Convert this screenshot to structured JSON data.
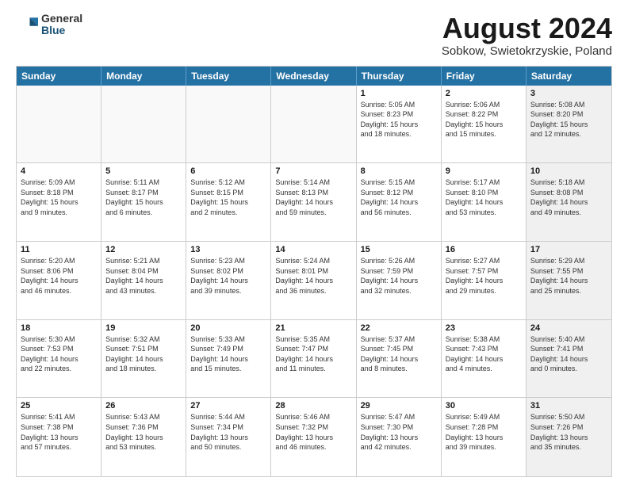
{
  "logo": {
    "general": "General",
    "blue": "Blue"
  },
  "title": "August 2024",
  "location": "Sobkow, Swietokrzyskie, Poland",
  "dayHeaders": [
    "Sunday",
    "Monday",
    "Tuesday",
    "Wednesday",
    "Thursday",
    "Friday",
    "Saturday"
  ],
  "rows": [
    [
      {
        "date": "",
        "info": "",
        "empty": true
      },
      {
        "date": "",
        "info": "",
        "empty": true
      },
      {
        "date": "",
        "info": "",
        "empty": true
      },
      {
        "date": "",
        "info": "",
        "empty": true
      },
      {
        "date": "1",
        "info": "Sunrise: 5:05 AM\nSunset: 8:23 PM\nDaylight: 15 hours\nand 18 minutes."
      },
      {
        "date": "2",
        "info": "Sunrise: 5:06 AM\nSunset: 8:22 PM\nDaylight: 15 hours\nand 15 minutes."
      },
      {
        "date": "3",
        "info": "Sunrise: 5:08 AM\nSunset: 8:20 PM\nDaylight: 15 hours\nand 12 minutes.",
        "shaded": true
      }
    ],
    [
      {
        "date": "4",
        "info": "Sunrise: 5:09 AM\nSunset: 8:18 PM\nDaylight: 15 hours\nand 9 minutes."
      },
      {
        "date": "5",
        "info": "Sunrise: 5:11 AM\nSunset: 8:17 PM\nDaylight: 15 hours\nand 6 minutes."
      },
      {
        "date": "6",
        "info": "Sunrise: 5:12 AM\nSunset: 8:15 PM\nDaylight: 15 hours\nand 2 minutes."
      },
      {
        "date": "7",
        "info": "Sunrise: 5:14 AM\nSunset: 8:13 PM\nDaylight: 14 hours\nand 59 minutes."
      },
      {
        "date": "8",
        "info": "Sunrise: 5:15 AM\nSunset: 8:12 PM\nDaylight: 14 hours\nand 56 minutes."
      },
      {
        "date": "9",
        "info": "Sunrise: 5:17 AM\nSunset: 8:10 PM\nDaylight: 14 hours\nand 53 minutes."
      },
      {
        "date": "10",
        "info": "Sunrise: 5:18 AM\nSunset: 8:08 PM\nDaylight: 14 hours\nand 49 minutes.",
        "shaded": true
      }
    ],
    [
      {
        "date": "11",
        "info": "Sunrise: 5:20 AM\nSunset: 8:06 PM\nDaylight: 14 hours\nand 46 minutes."
      },
      {
        "date": "12",
        "info": "Sunrise: 5:21 AM\nSunset: 8:04 PM\nDaylight: 14 hours\nand 43 minutes."
      },
      {
        "date": "13",
        "info": "Sunrise: 5:23 AM\nSunset: 8:02 PM\nDaylight: 14 hours\nand 39 minutes."
      },
      {
        "date": "14",
        "info": "Sunrise: 5:24 AM\nSunset: 8:01 PM\nDaylight: 14 hours\nand 36 minutes."
      },
      {
        "date": "15",
        "info": "Sunrise: 5:26 AM\nSunset: 7:59 PM\nDaylight: 14 hours\nand 32 minutes."
      },
      {
        "date": "16",
        "info": "Sunrise: 5:27 AM\nSunset: 7:57 PM\nDaylight: 14 hours\nand 29 minutes."
      },
      {
        "date": "17",
        "info": "Sunrise: 5:29 AM\nSunset: 7:55 PM\nDaylight: 14 hours\nand 25 minutes.",
        "shaded": true
      }
    ],
    [
      {
        "date": "18",
        "info": "Sunrise: 5:30 AM\nSunset: 7:53 PM\nDaylight: 14 hours\nand 22 minutes."
      },
      {
        "date": "19",
        "info": "Sunrise: 5:32 AM\nSunset: 7:51 PM\nDaylight: 14 hours\nand 18 minutes."
      },
      {
        "date": "20",
        "info": "Sunrise: 5:33 AM\nSunset: 7:49 PM\nDaylight: 14 hours\nand 15 minutes."
      },
      {
        "date": "21",
        "info": "Sunrise: 5:35 AM\nSunset: 7:47 PM\nDaylight: 14 hours\nand 11 minutes."
      },
      {
        "date": "22",
        "info": "Sunrise: 5:37 AM\nSunset: 7:45 PM\nDaylight: 14 hours\nand 8 minutes."
      },
      {
        "date": "23",
        "info": "Sunrise: 5:38 AM\nSunset: 7:43 PM\nDaylight: 14 hours\nand 4 minutes."
      },
      {
        "date": "24",
        "info": "Sunrise: 5:40 AM\nSunset: 7:41 PM\nDaylight: 14 hours\nand 0 minutes.",
        "shaded": true
      }
    ],
    [
      {
        "date": "25",
        "info": "Sunrise: 5:41 AM\nSunset: 7:38 PM\nDaylight: 13 hours\nand 57 minutes."
      },
      {
        "date": "26",
        "info": "Sunrise: 5:43 AM\nSunset: 7:36 PM\nDaylight: 13 hours\nand 53 minutes."
      },
      {
        "date": "27",
        "info": "Sunrise: 5:44 AM\nSunset: 7:34 PM\nDaylight: 13 hours\nand 50 minutes."
      },
      {
        "date": "28",
        "info": "Sunrise: 5:46 AM\nSunset: 7:32 PM\nDaylight: 13 hours\nand 46 minutes."
      },
      {
        "date": "29",
        "info": "Sunrise: 5:47 AM\nSunset: 7:30 PM\nDaylight: 13 hours\nand 42 minutes."
      },
      {
        "date": "30",
        "info": "Sunrise: 5:49 AM\nSunset: 7:28 PM\nDaylight: 13 hours\nand 39 minutes."
      },
      {
        "date": "31",
        "info": "Sunrise: 5:50 AM\nSunset: 7:26 PM\nDaylight: 13 hours\nand 35 minutes.",
        "shaded": true
      }
    ]
  ]
}
